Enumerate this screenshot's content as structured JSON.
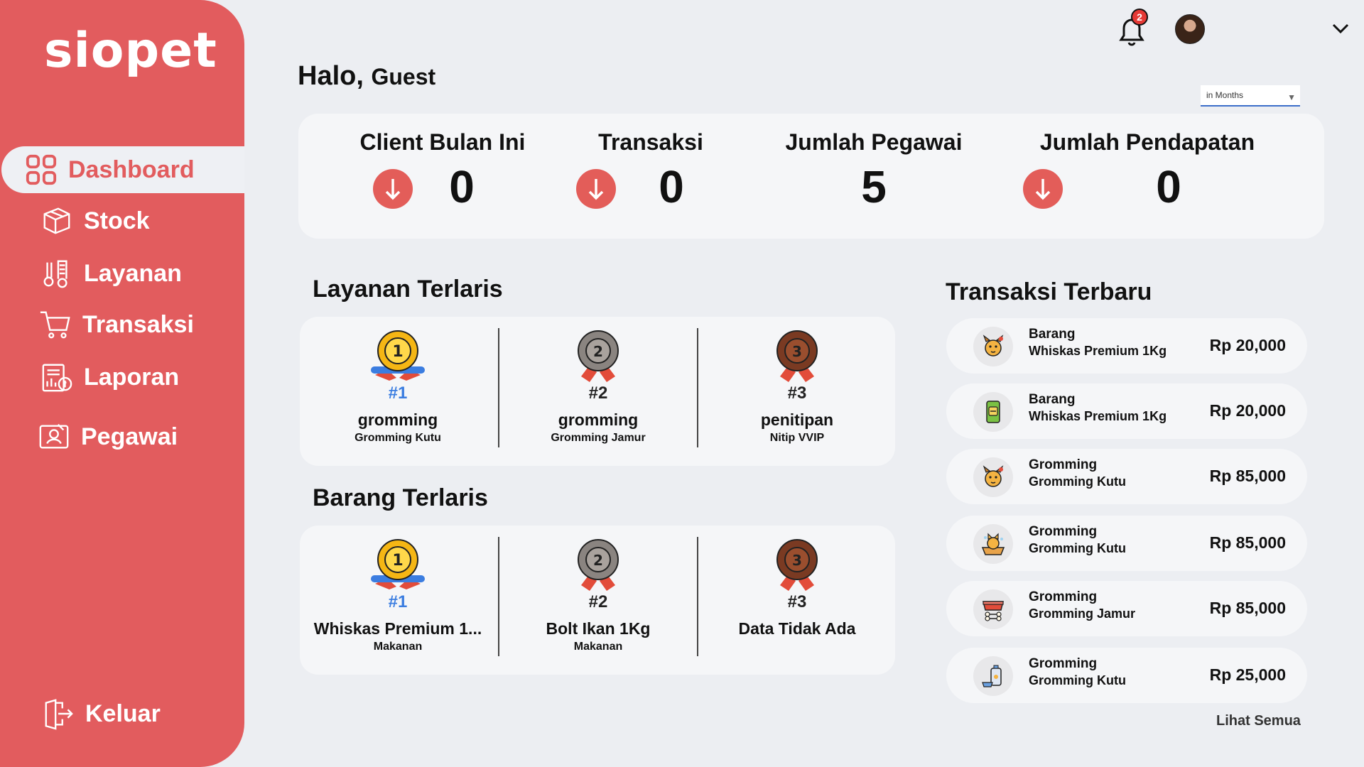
{
  "app": {
    "logo": "siopet"
  },
  "sidebar": {
    "items": [
      {
        "label": "Dashboard",
        "icon": "grid-icon",
        "active": true
      },
      {
        "label": "Stock",
        "icon": "box-icon"
      },
      {
        "label": "Layanan",
        "icon": "grooming-icon"
      },
      {
        "label": "Transaksi",
        "icon": "cart-icon"
      },
      {
        "label": "Laporan",
        "icon": "report-icon"
      },
      {
        "label": "Pegawai",
        "icon": "employee-icon"
      }
    ],
    "logout": {
      "label": "Keluar",
      "icon": "logout-icon"
    }
  },
  "topbar": {
    "notification_count": "2",
    "icons": [
      "bell-icon",
      "avatar",
      "chevron-down-icon"
    ]
  },
  "header": {
    "greeting": "Halo,",
    "user": "Guest"
  },
  "period_select": {
    "selected": "in Months"
  },
  "stats": [
    {
      "label": "Client Bulan Ini",
      "value": "0",
      "trend": "down"
    },
    {
      "label": "Transaksi",
      "value": "0",
      "trend": "down"
    },
    {
      "label": "Jumlah Pegawai",
      "value": "5",
      "trend": "none"
    },
    {
      "label": "Jumlah Pendapatan",
      "value": "0",
      "trend": "down"
    }
  ],
  "layanan_terlaris": {
    "title": "Layanan Terlaris",
    "items": [
      {
        "rank": "#1",
        "name": "gromming",
        "sub": "Gromming Kutu"
      },
      {
        "rank": "#2",
        "name": "gromming",
        "sub": "Gromming Jamur"
      },
      {
        "rank": "#3",
        "name": "penitipan",
        "sub": "Nitip VVIP"
      }
    ]
  },
  "barang_terlaris": {
    "title": "Barang Terlaris",
    "items": [
      {
        "rank": "#1",
        "name": "Whiskas Premium 1...",
        "sub": "Makanan"
      },
      {
        "rank": "#2",
        "name": "Bolt Ikan 1Kg",
        "sub": "Makanan"
      },
      {
        "rank": "#3",
        "name": "Data Tidak Ada",
        "sub": ""
      }
    ]
  },
  "transaksi_terbaru": {
    "title": "Transaksi Terbaru",
    "items": [
      {
        "type": "Barang",
        "name": "Whiskas Premium 1Kg",
        "price": "Rp 20,000",
        "icon": "dog-icon"
      },
      {
        "type": "Barang",
        "name": "Whiskas Premium 1Kg",
        "price": "Rp 20,000",
        "icon": "pet-food-icon"
      },
      {
        "type": "Gromming",
        "name": "Gromming Kutu",
        "price": "Rp 85,000",
        "icon": "dog-icon"
      },
      {
        "type": "Gromming",
        "name": "Gromming Kutu",
        "price": "Rp 85,000",
        "icon": "cat-bath-icon"
      },
      {
        "type": "Gromming",
        "name": "Gromming Jamur",
        "price": "Rp 85,000",
        "icon": "bowl-bone-icon"
      },
      {
        "type": "Gromming",
        "name": "Gromming Kutu",
        "price": "Rp 25,000",
        "icon": "shampoo-icon"
      }
    ],
    "see_all": "Lihat Semua"
  }
}
